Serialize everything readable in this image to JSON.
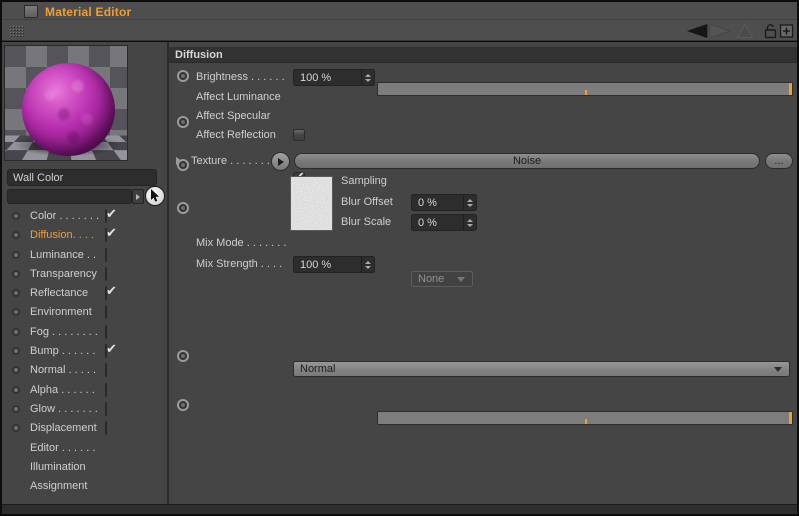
{
  "window": {
    "title": "Material Editor"
  },
  "toolbar": {
    "icons": [
      "drag-grip-icon",
      "back-arrow-icon",
      "forward-arrow-icon",
      "up-arrow-icon",
      "lock-icon",
      "add-icon"
    ]
  },
  "sidebar": {
    "material_name": "Wall Color",
    "reference_field_value": "",
    "channels": [
      {
        "label": "Color . . . . . . .",
        "checkbox": true,
        "checked": true,
        "active": false
      },
      {
        "label": "Diffusion. . . .",
        "checkbox": true,
        "checked": true,
        "active": true
      },
      {
        "label": "Luminance . .",
        "checkbox": true,
        "checked": false,
        "active": false
      },
      {
        "label": "Transparency",
        "checkbox": true,
        "checked": false,
        "active": false
      },
      {
        "label": "Reflectance",
        "checkbox": true,
        "checked": true,
        "active": false
      },
      {
        "label": "Environment",
        "checkbox": true,
        "checked": false,
        "active": false
      },
      {
        "label": "Fog . . . . . . . .",
        "checkbox": true,
        "checked": false,
        "active": false
      },
      {
        "label": "Bump . . . . . .",
        "checkbox": true,
        "checked": true,
        "active": false
      },
      {
        "label": "Normal . . . . .",
        "checkbox": true,
        "checked": false,
        "active": false
      },
      {
        "label": "Alpha . . . . . .",
        "checkbox": true,
        "checked": false,
        "active": false
      },
      {
        "label": "Glow . . . . . . .",
        "checkbox": true,
        "checked": false,
        "active": false
      },
      {
        "label": "Displacement",
        "checkbox": true,
        "checked": false,
        "active": false
      },
      {
        "label": "Editor . . . . . .",
        "checkbox": false,
        "checked": false,
        "active": false
      },
      {
        "label": "Illumination",
        "checkbox": false,
        "checked": false,
        "active": false
      },
      {
        "label": "Assignment",
        "checkbox": false,
        "checked": false,
        "active": false
      }
    ]
  },
  "main": {
    "section_title": "Diffusion",
    "brightness": {
      "label": "Brightness . . . . . .",
      "value": "100 %",
      "slider_pct": 100
    },
    "affect_luminance": {
      "label": "Affect Luminance",
      "checked": false
    },
    "affect_specular": {
      "label": "Affect Specular",
      "checked": true
    },
    "affect_reflection": {
      "label": "Affect Reflection",
      "checked": false
    },
    "texture": {
      "label": "Texture . . . . . . . . .",
      "shader_name": "Noise",
      "browse_label": "..."
    },
    "sampling": {
      "label": "Sampling",
      "value": "None",
      "disabled": true
    },
    "blur_offset": {
      "label": "Blur Offset",
      "value": "0 %"
    },
    "blur_scale": {
      "label": "Blur Scale",
      "value": "0 %"
    },
    "mix_mode": {
      "label": "Mix Mode . . . . . . .",
      "value": "Normal"
    },
    "mix_strength": {
      "label": "Mix Strength  . . . .",
      "value": "100 %",
      "slider_pct": 100
    }
  },
  "colors": {
    "accent_orange": "#f09f30",
    "panel_bg": "#454545",
    "header_bg": "#323232",
    "slider_track": "#7d7d7d",
    "sphere_magenta": "#b62fae"
  }
}
